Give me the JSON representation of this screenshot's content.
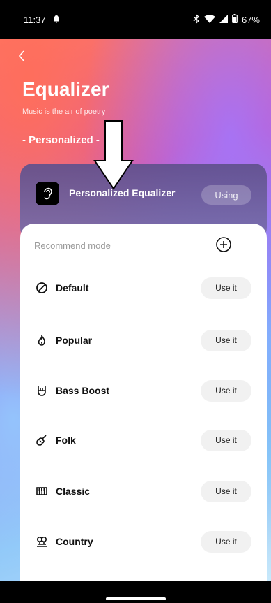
{
  "status": {
    "time": "11:37",
    "battery": "67%"
  },
  "header": {
    "title": "Equalizer",
    "subtitle": "Music is the air of poetry",
    "mode": "- Personalized -"
  },
  "personalized": {
    "title": "Personalized Equalizer",
    "status": "Using"
  },
  "recommend": {
    "label": "Recommend mode",
    "items": [
      {
        "label": "Default",
        "action": "Use it",
        "icon": "slash-circle-icon"
      },
      {
        "label": "Popular",
        "action": "Use it",
        "icon": "flame-icon"
      },
      {
        "label": "Bass Boost",
        "action": "Use it",
        "icon": "rock-hand-icon"
      },
      {
        "label": "Folk",
        "action": "Use it",
        "icon": "guitar-icon"
      },
      {
        "label": "Classic",
        "action": "Use it",
        "icon": "piano-icon"
      },
      {
        "label": "Country",
        "action": "Use it",
        "icon": "country-icon"
      }
    ]
  },
  "colors": {
    "accent_top": "#ff7a6a",
    "accent_mid": "#8a5be8",
    "accent_bottom": "#8fc2f3"
  }
}
